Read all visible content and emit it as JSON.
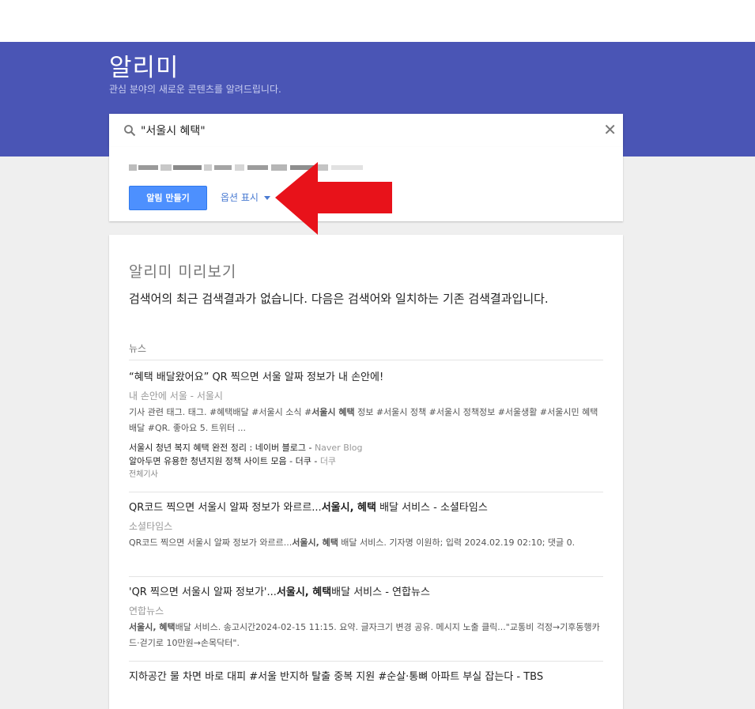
{
  "app": {
    "title": "알리미",
    "subtitle": "관심 분야의 새로운 콘텐츠를 알려드립니다."
  },
  "search": {
    "value": "\"서울시 혜택\"",
    "clear_icon": "close-icon"
  },
  "options": {
    "create_button": "알림 만들기",
    "show_options": "옵션 표시"
  },
  "preview": {
    "title": "알리미 미리보기",
    "notice": "검색어의 최근 검색결과가 없습니다. 다음은 검색어와 일치하는 기존 검색결과입니다.",
    "section": "뉴스",
    "articles": [
      {
        "title": "“혜택 배달왔어요” QR 찍으면 서울 알짜 정보가 내 손안에!",
        "source": "내 손안에 서울 - 서울시",
        "snippet_pre": "기사 관련 태그. 태그. #혜택배달 #서울시 소식 #",
        "snippet_bold": "서울시 혜택",
        "snippet_post": " 정보 #서울시 정책 #서울시 정책정보 #서울생활 #서울시민 혜택배달 #QR. 좋아요 5. 트위터 ...",
        "related": [
          {
            "title": "서울시 청년 복지 혜택 완전 정리 : 네이버 블로그",
            "source": "Naver Blog"
          },
          {
            "title": "알아두면 유용한 청년지원 정책 사이트 모음 - 더쿠",
            "source": "더쿠"
          }
        ],
        "all_label": "전체기사"
      },
      {
        "title_pre": "QR코드 찍으면 서울시 알짜 정보가 와르르...",
        "title_bold": "서울시, 혜택",
        "title_post": " 배달 서비스 - 소셜타임스",
        "source": "소셜타임스",
        "snippet_pre": "QR코드 찍으면 서울시 알짜 정보가 와르르...",
        "snippet_bold": "서울시, 혜택",
        "snippet_post": " 배달 서비스. 기자명 이원하; 입력 2024.02.19 02:10; 댓글 0."
      },
      {
        "title_pre": "'QR 찍으면 서울시 알짜 정보가'...",
        "title_bold": "서울시, 혜택",
        "title_post": "배달 서비스 - 연합뉴스",
        "source": "연합뉴스",
        "snippet_bold": "서울시, 혜택",
        "snippet_post": "배달 서비스. 송고시간2024-02-15 11:15. 요약. 글자크기 변경 공유. 메시지 노출 클릭...\"교통비 걱정→기후동행카드·걷기로 10만원→손목닥터\"."
      },
      {
        "title": "지하공간 물 차면 바로 대피 #서울 반지하 탈출 중복 지원 #순살·통뼈 아파트 부실 잡는다 - TBS"
      }
    ]
  },
  "colors": {
    "header": "#4a55b5",
    "button": "#4d90fe",
    "link": "#4a7bd2",
    "arrow": "#e8121a"
  }
}
